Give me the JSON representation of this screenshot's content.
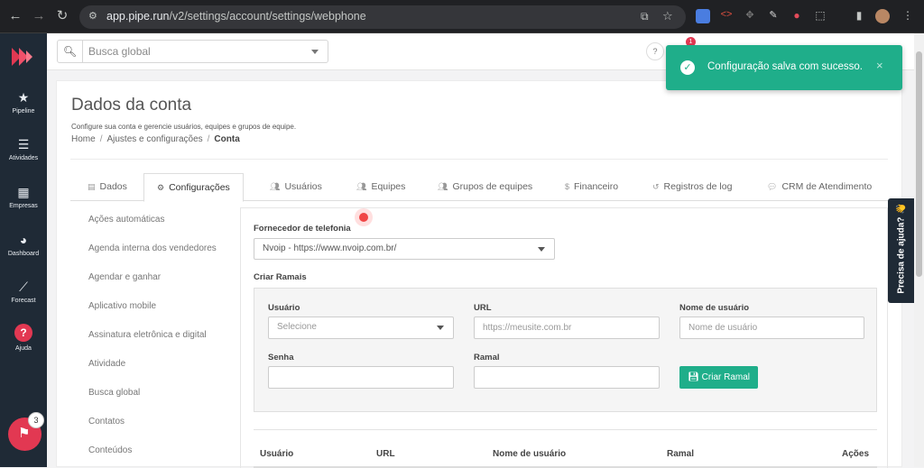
{
  "browser": {
    "url_host": "app.pipe.run",
    "url_path": "/v2/settings/account/settings/webphone"
  },
  "sidebar": {
    "items": [
      {
        "label": "Pipeline",
        "icon": "star-icon"
      },
      {
        "label": "Atividades",
        "icon": "list-icon"
      },
      {
        "label": "Empresas",
        "icon": "building-icon"
      },
      {
        "label": "Dashboard",
        "icon": "gauge-icon"
      },
      {
        "label": "Forecast",
        "icon": "chart-line-icon"
      },
      {
        "label": "Ajuda",
        "icon": "help-icon"
      }
    ],
    "fab_badge": "3"
  },
  "topbar": {
    "search_placeholder": "Busca global",
    "help": "?",
    "notif_badge": "1"
  },
  "page": {
    "title": "Dados da conta",
    "subtitle": "Configure sua conta e gerencie usuários, equipes e grupos de equipe.",
    "breadcrumb": [
      "Home",
      "Ajustes e configurações",
      "Conta"
    ]
  },
  "tabs": [
    {
      "label": "Dados"
    },
    {
      "label": "Configurações"
    },
    {
      "label": "Usuários"
    },
    {
      "label": "Equipes"
    },
    {
      "label": "Grupos de equipes"
    },
    {
      "label": "Financeiro"
    },
    {
      "label": "Registros de log"
    },
    {
      "label": "CRM de Atendimento"
    }
  ],
  "left_menu": [
    "Ações automáticas",
    "Agenda interna dos vendedores",
    "Agendar e ganhar",
    "Aplicativo mobile",
    "Assinatura eletrônica e digital",
    "Atividade",
    "Busca global",
    "Contatos",
    "Conteúdos"
  ],
  "form": {
    "provider_label": "Fornecedor de telefonia",
    "provider_value": "Nvoip - https://www.nvoip.com.br/",
    "section_label": "Criar Ramais",
    "usuario_label": "Usuário",
    "usuario_placeholder": "Selecione",
    "url_label": "URL",
    "url_placeholder": "https://meusite.com.br",
    "username_label": "Nome de usuário",
    "username_placeholder": "Nome de usuário",
    "senha_label": "Senha",
    "ramal_label": "Ramal",
    "create_button": "Criar Ramal"
  },
  "table": {
    "headers": [
      "Usuário",
      "URL",
      "Nome de usuário",
      "Ramal",
      "Ações"
    ]
  },
  "toast": {
    "message": "Configuração salva com sucesso.",
    "close": "×"
  },
  "help_tab": "Precisa de ajuda? 👋",
  "colors": {
    "accent": "#1fae8a",
    "sidebar": "#1f2a36",
    "brand": "#e23852"
  }
}
